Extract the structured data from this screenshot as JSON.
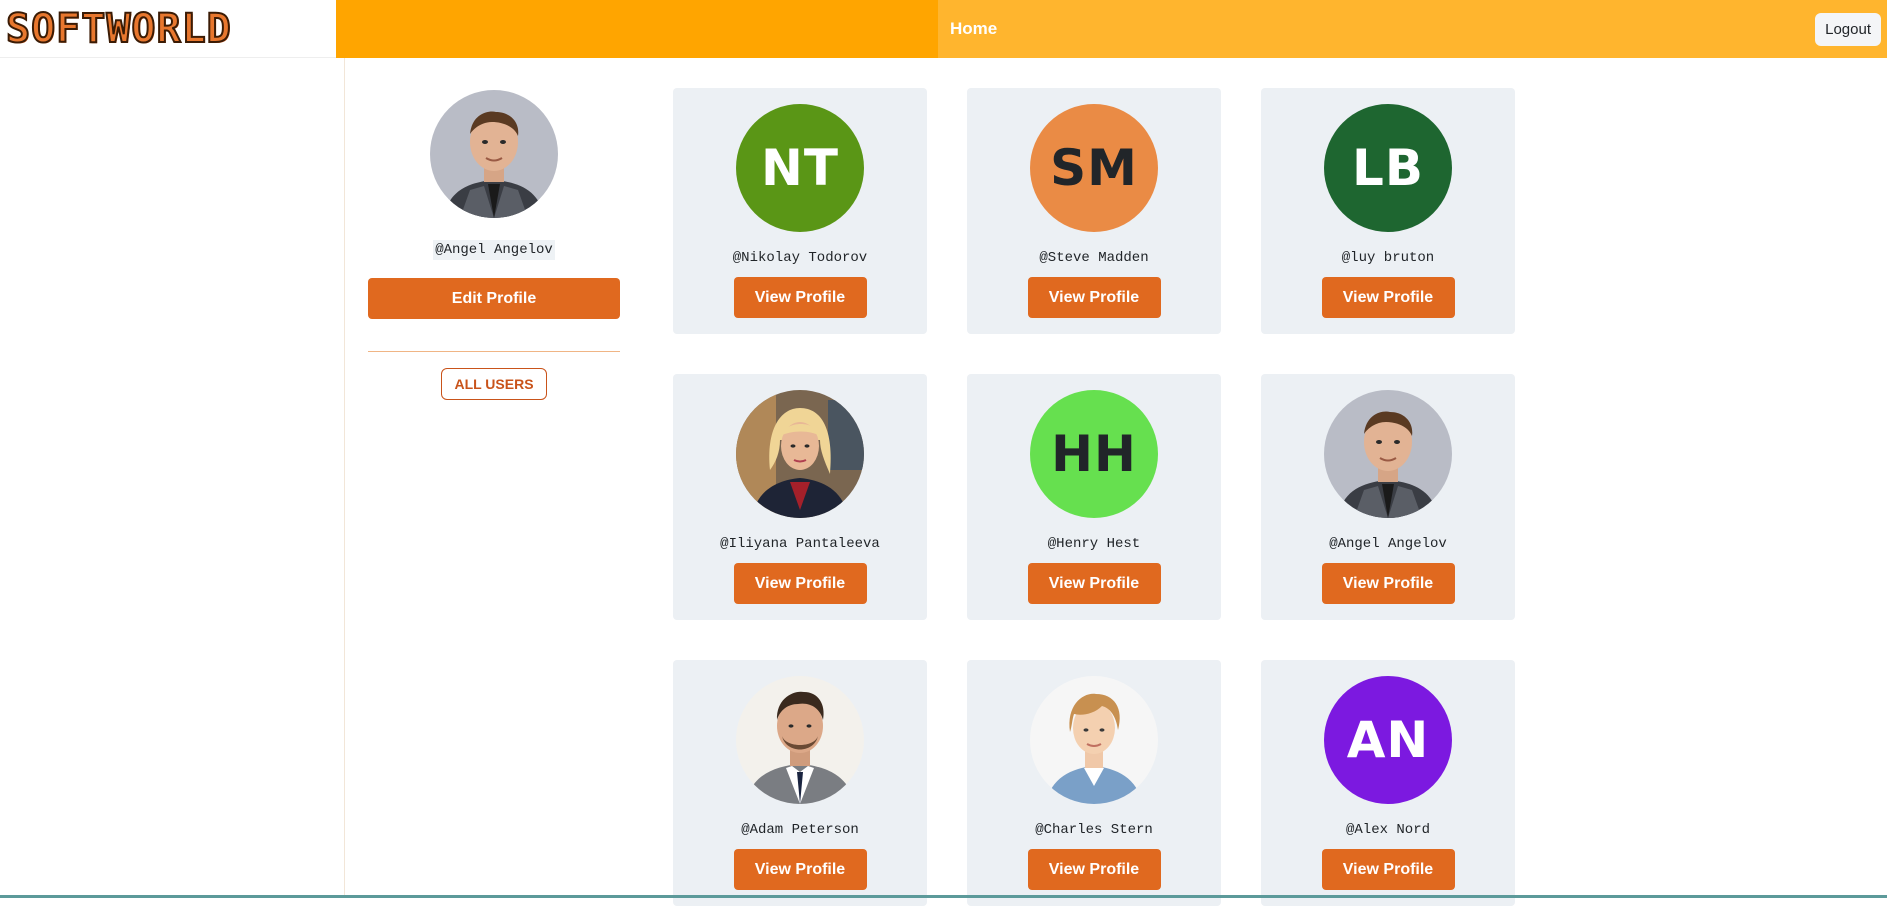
{
  "header": {
    "logo": "SOFTWORLD",
    "home_label": "Home",
    "logout_label": "Logout"
  },
  "current_user": {
    "username": "@Angel Angelov",
    "edit_label": "Edit Profile",
    "all_users_label": "ALL USERS"
  },
  "users": [
    {
      "username": "@Nikolay Todorov",
      "initials": "NT",
      "avatar_color": "#5a9616",
      "text_color": "#ffffff",
      "photo": "",
      "button": "View Profile"
    },
    {
      "username": "@Steve Madden",
      "initials": "SM",
      "avatar_color": "#ea8b45",
      "text_color": "#212529",
      "photo": "",
      "button": "View Profile"
    },
    {
      "username": "@luy bruton",
      "initials": "LB",
      "avatar_color": "#1e6630",
      "text_color": "#ffffff",
      "photo": "",
      "button": "View Profile"
    },
    {
      "username": "@Iliyana Pantaleeva",
      "initials": "",
      "avatar_color": "#8a6a4a",
      "text_color": "#ffffff",
      "photo": "woman-blonde",
      "button": "View Profile"
    },
    {
      "username": "@Henry Hest",
      "initials": "HH",
      "avatar_color": "#66e04f",
      "text_color": "#212529",
      "photo": "",
      "button": "View Profile"
    },
    {
      "username": "@Angel Angelov",
      "initials": "",
      "avatar_color": "#b9bcc6",
      "text_color": "#ffffff",
      "photo": "man-checkered",
      "button": "View Profile"
    },
    {
      "username": "@Adam Peterson",
      "initials": "",
      "avatar_color": "#f3f1ec",
      "text_color": "#ffffff",
      "photo": "man-suit",
      "button": "View Profile"
    },
    {
      "username": "@Charles Stern",
      "initials": "",
      "avatar_color": "#f6f6f6",
      "text_color": "#ffffff",
      "photo": "young-man",
      "button": "View Profile"
    },
    {
      "username": "@Alex Nord",
      "initials": "AN",
      "avatar_color": "#7c19e0",
      "text_color": "#ffffff",
      "photo": "",
      "button": "View Profile"
    }
  ]
}
